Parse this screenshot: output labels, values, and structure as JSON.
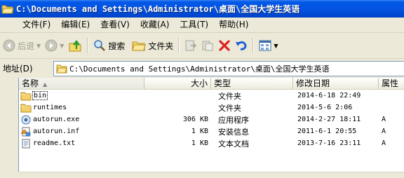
{
  "window": {
    "title": "C:\\Documents and Settings\\Administrator\\桌面\\全国大学生英语"
  },
  "menu": {
    "items": [
      "文件(F)",
      "编辑(E)",
      "查看(V)",
      "收藏(A)",
      "工具(T)",
      "帮助(H)"
    ]
  },
  "toolbar": {
    "back_label": "后退",
    "search_label": "搜索",
    "folders_label": "文件夹"
  },
  "address": {
    "label": "地址(D)",
    "value": "C:\\Documents and Settings\\Administrator\\桌面\\全国大学生英语"
  },
  "list": {
    "columns": {
      "name": "名称",
      "size": "大小",
      "type": "类型",
      "modified": "修改日期",
      "attributes": "属性"
    },
    "rows": [
      {
        "name": "bin",
        "size": "",
        "type": "文件夹",
        "modified": "2014-6-18 22:49",
        "attr": "",
        "icon": "folder-icon"
      },
      {
        "name": "runtimes",
        "size": "",
        "type": "文件夹",
        "modified": "2014-5-6 2:06",
        "attr": "",
        "icon": "folder-icon"
      },
      {
        "name": "autorun.exe",
        "size": "306 KB",
        "type": "应用程序",
        "modified": "2014-2-27 18:11",
        "attr": "A",
        "icon": "exe-icon"
      },
      {
        "name": "autorun.inf",
        "size": "1 KB",
        "type": "安装信息",
        "modified": "2011-6-1 20:55",
        "attr": "A",
        "icon": "setup-info-icon"
      },
      {
        "name": "readme.txt",
        "size": "1 KB",
        "type": "文本文档",
        "modified": "2013-7-16 23:11",
        "attr": "A",
        "icon": "text-document-icon"
      }
    ]
  },
  "colors": {
    "title_bar": "#0554e3",
    "chrome": "#ece9d8",
    "delete_red": "#e02020",
    "folder_yellow": "#f4d06b"
  }
}
